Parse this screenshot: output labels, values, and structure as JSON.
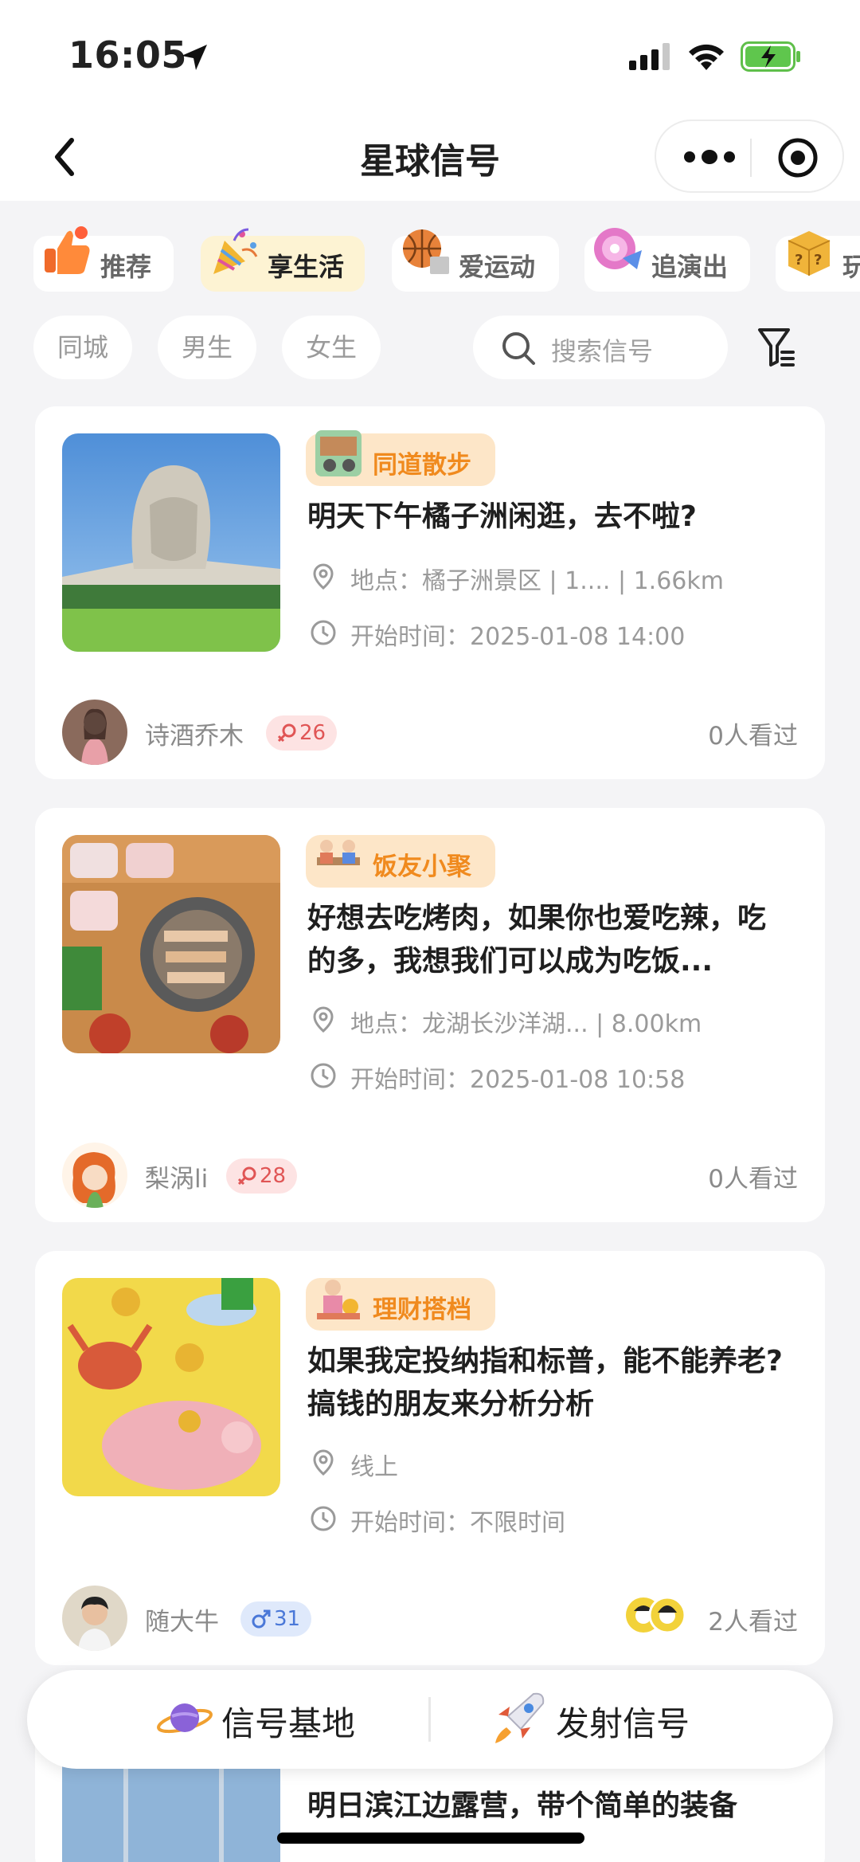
{
  "status_bar": {
    "time": "16:05"
  },
  "nav": {
    "title": "星球信号"
  },
  "tabs": [
    {
      "label": "推荐",
      "icon": "thumbs-up-icon",
      "active": false
    },
    {
      "label": "享生活",
      "icon": "party-popper-icon",
      "active": true
    },
    {
      "label": "爱运动",
      "icon": "basketball-icon",
      "active": false
    },
    {
      "label": "追演出",
      "icon": "music-disc-icon",
      "active": false
    },
    {
      "label": "玩",
      "icon": "game-box-icon",
      "active": false
    }
  ],
  "filters": {
    "chips": [
      "同城",
      "男生",
      "女生"
    ],
    "search_placeholder": "搜索信号"
  },
  "cards": [
    {
      "tag": "同道散步",
      "title": "明天下午橘子洲闲逛，去不啦?",
      "location": "地点：橘子洲景区 | 1....  | 1.66km",
      "time": "开始时间：2025-01-08 14:00",
      "author": "诗酒乔木",
      "gender": "female",
      "badge": "26",
      "views": "0人看过"
    },
    {
      "tag": "饭友小聚",
      "title": "好想去吃烤肉，如果你也爱吃辣，吃的多，我想我们可以成为吃饭...",
      "location": "地点：龙湖长沙洋湖...     | 8.00km",
      "time": "开始时间：2025-01-08 10:58",
      "author": "梨涡li",
      "gender": "female",
      "badge": "28",
      "views": "0人看过"
    },
    {
      "tag": "理财搭档",
      "title": "如果我定投纳指和标普，能不能养老?搞钱的朋友来分析分析",
      "location": "线上",
      "time": "开始时间：不限时间",
      "author": "随大牛",
      "gender": "male",
      "badge": "31",
      "views": "2人看过"
    },
    {
      "title": "明日滨江边露营，带个简单的装备"
    }
  ],
  "bottom_bar": {
    "left_label": "信号基地",
    "right_label": "发射信号"
  },
  "colors": {
    "accent_orange": "#f08a1e",
    "active_tab_bg": "#fdf3d3",
    "tag_bg": "#fde6c8",
    "female_badge": "#e05555",
    "male_badge": "#4a78d8"
  }
}
